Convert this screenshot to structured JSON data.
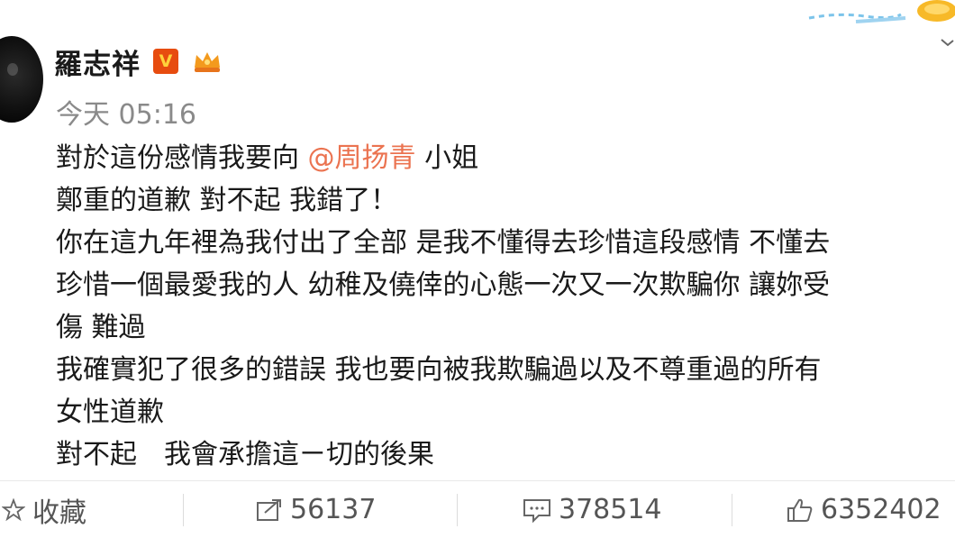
{
  "post": {
    "author": "羅志祥",
    "vip_badge": "V",
    "timestamp": "今天 05:16",
    "lines": [
      {
        "before": "對於這份感情我要向 ",
        "mention": "@周扬青",
        "after": " 小姐"
      },
      {
        "text": "鄭重的道歉 對不起 我錯了！"
      },
      {
        "text": "你在這九年裡為我付出了全部 是我不懂得去珍惜這段感情 不懂去"
      },
      {
        "text": "珍惜一個最愛我的人 幼稚及僥倖的心態一次又一次欺騙你 讓妳受"
      },
      {
        "text": "傷 難過"
      },
      {
        "text": "我確實犯了很多的錯誤 我也要向被我欺騙過以及不尊重過的所有"
      },
      {
        "text": "女性道歉"
      },
      {
        "text": "對不起　我會承擔這ㄧ切的後果"
      }
    ]
  },
  "actions": {
    "favorite_label": "收藏",
    "repost_count": "56137",
    "comment_count": "378514",
    "like_count": "6352402"
  },
  "icons": {
    "favorite": "star-icon",
    "repost": "repost-icon",
    "comment": "comment-icon",
    "like": "thumbs-up-icon",
    "vip": "verified-v-icon",
    "crown": "crown-icon"
  },
  "colors": {
    "mention": "#eb7350",
    "timestamp": "#8a8a8a",
    "vip_bg": "#e74c0f",
    "accent_yellow": "#ffd23b"
  }
}
